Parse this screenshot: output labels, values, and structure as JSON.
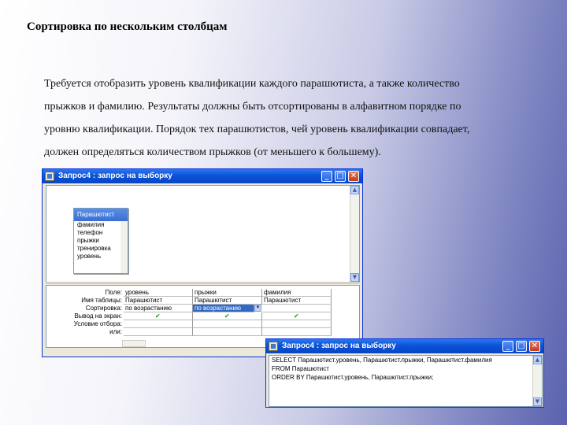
{
  "slide": {
    "title": "Сортировка по нескольким столбцам",
    "body_lines": [
      "Требуется отобразить уровень квалификации каждого парашютиста, а также количество",
      "прыжков и фамилию. Результаты должны быть отсортированы в алфавитном порядке по",
      "уровню квалификации. Порядок тех парашютистов, чей уровень квалификации совпадает,",
      "должен определяться количеством прыжков (от меньшего к большему)."
    ]
  },
  "query_window": {
    "title": "Запрос4 : запрос на выборку",
    "field_list": {
      "title": "Парашютист",
      "items": [
        "фамилия",
        "телефон",
        "прыжки",
        "тренировка",
        "уровень"
      ]
    },
    "grid": {
      "row_labels": [
        "Поле:",
        "Имя таблицы:",
        "Сортировка:",
        "Вывод на экран:",
        "Условие отбора:",
        "или:"
      ],
      "columns": [
        {
          "field": "уровень",
          "table": "Парашютист",
          "sort": "по возрастанию"
        },
        {
          "field": "прыжки",
          "table": "Парашютист",
          "sort": "по возрастанию"
        },
        {
          "field": "фамилия",
          "table": "Парашютист",
          "sort": ""
        }
      ],
      "check_glyph": "✔"
    }
  },
  "sql_window": {
    "title": "Запрос4 : запрос на выборку",
    "lines": [
      "SELECT Парашютист.уровень, Парашютист.прыжки, Парашютист.фамилия",
      "FROM Парашютист",
      "ORDER BY Парашютист.уровень, Парашютист.прыжки;"
    ]
  },
  "glyphs": {
    "minimize": "_",
    "maximize": "□",
    "close": "✕",
    "up": "▲",
    "down": "▼",
    "dropdown": "▼"
  }
}
